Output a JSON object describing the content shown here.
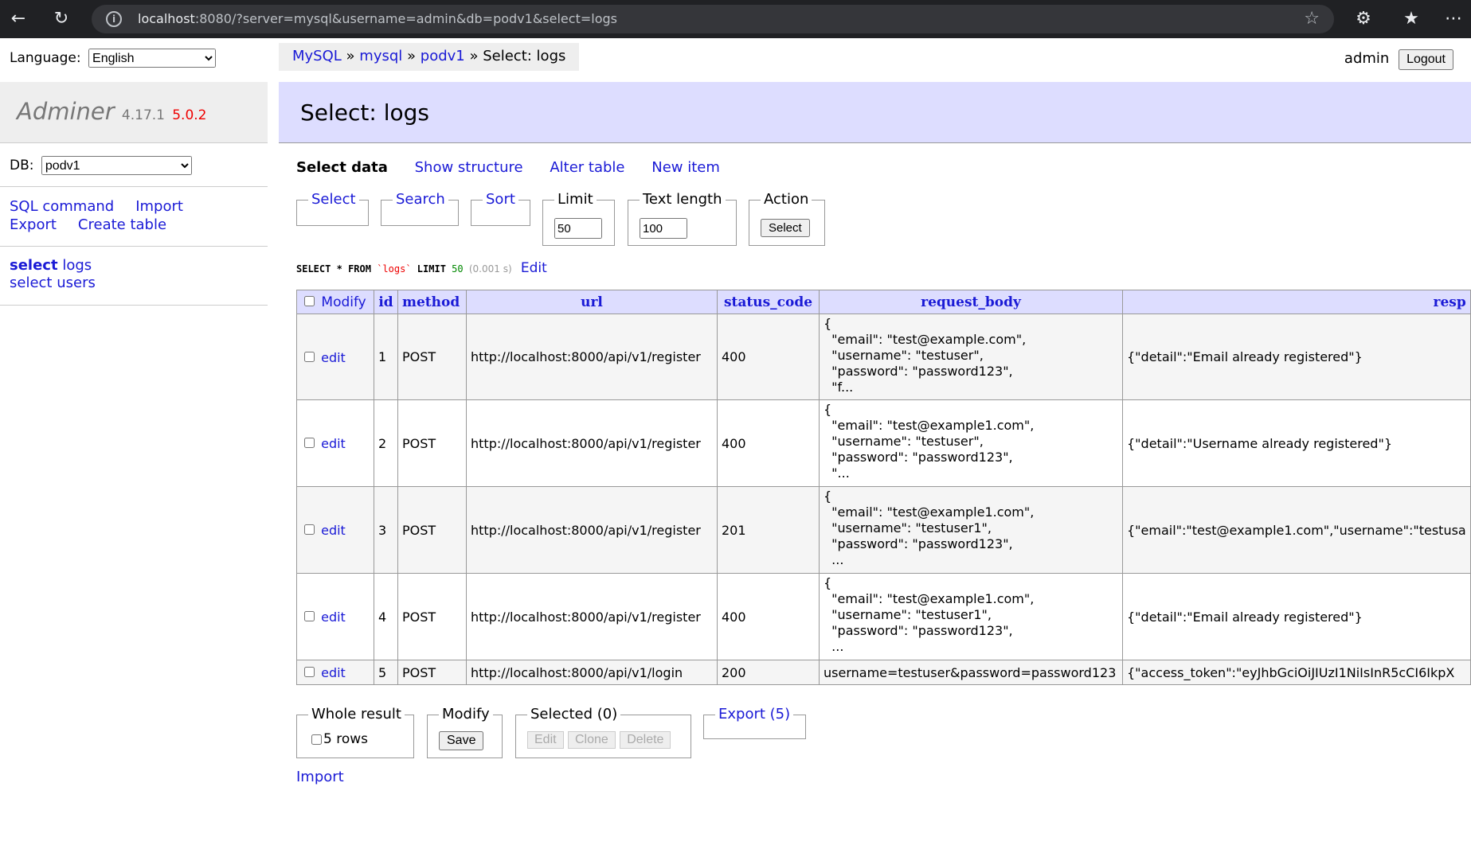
{
  "browser": {
    "url_host": "localhost",
    "url_rest": ":8080/?server=mysql&username=admin&db=podv1&select=logs"
  },
  "sidebar": {
    "language_label": "Language:",
    "language_value": "English",
    "app_name": "Adminer",
    "version": "4.17.1",
    "new_version": "5.0.2",
    "db_label": "DB:",
    "db_value": "podv1",
    "links": [
      "SQL command",
      "Import",
      "Export",
      "Create table"
    ],
    "tables": [
      {
        "action": "select",
        "name": "logs"
      },
      {
        "action": "select",
        "name": "users"
      }
    ]
  },
  "breadcrumb": {
    "items": [
      "MySQL",
      "mysql",
      "podv1"
    ],
    "current": "Select: logs",
    "separator": "»"
  },
  "header": {
    "user": "admin",
    "logout_label": "Logout",
    "title": "Select: logs"
  },
  "menu": {
    "items": [
      "Select data",
      "Show structure",
      "Alter table",
      "New item"
    ]
  },
  "filters": {
    "select_label": "Select",
    "search_label": "Search",
    "sort_label": "Sort",
    "limit_label": "Limit",
    "limit_value": "50",
    "text_length_label": "Text length",
    "text_length_value": "100",
    "action_label": "Action",
    "action_button": "Select"
  },
  "query": {
    "kw1": "SELECT",
    "star": "*",
    "kw2": "FROM",
    "table": "`logs`",
    "kw3": "LIMIT",
    "limit": "50",
    "time": "(0.001 s)",
    "edit_label": "Edit"
  },
  "table": {
    "headers": [
      "Modify",
      "id",
      "method",
      "url",
      "status_code",
      "request_body",
      "resp"
    ],
    "edit_label": "edit",
    "rows": [
      {
        "id": "1",
        "method": "POST",
        "url": "http://localhost:8000/api/v1/register",
        "status": "400",
        "body": [
          "{",
          "  \"email\": \"test@example.com\",",
          "  \"username\": \"testuser\",",
          "  \"password\": \"password123\",",
          "  \"f..."
        ],
        "resp": "{\"detail\":\"Email already registered\"}"
      },
      {
        "id": "2",
        "method": "POST",
        "url": "http://localhost:8000/api/v1/register",
        "status": "400",
        "body": [
          "{",
          "  \"email\": \"test@example1.com\",",
          "  \"username\": \"testuser\",",
          "  \"password\": \"password123\",",
          "  \"..."
        ],
        "resp": "{\"detail\":\"Username already registered\"}"
      },
      {
        "id": "3",
        "method": "POST",
        "url": "http://localhost:8000/api/v1/register",
        "status": "201",
        "body": [
          "{",
          "  \"email\": \"test@example1.com\",",
          "  \"username\": \"testuser1\",",
          "  \"password\": \"password123\",",
          "  ..."
        ],
        "resp": "{\"email\":\"test@example1.com\",\"username\":\"testusa"
      },
      {
        "id": "4",
        "method": "POST",
        "url": "http://localhost:8000/api/v1/register",
        "status": "400",
        "body": [
          "{",
          "  \"email\": \"test@example1.com\",",
          "  \"username\": \"testuser1\",",
          "  \"password\": \"password123\",",
          "  ..."
        ],
        "resp": "{\"detail\":\"Email already registered\"}"
      },
      {
        "id": "5",
        "method": "POST",
        "url": "http://localhost:8000/api/v1/login",
        "status": "200",
        "body": [
          "username=testuser&password=password123"
        ],
        "resp": "{\"access_token\":\"eyJhbGciOiJIUzI1NiIsInR5cCI6IkpX"
      }
    ]
  },
  "bottom": {
    "whole_result_label": "Whole result",
    "rows_label": "5 rows",
    "modify_label": "Modify",
    "save_label": "Save",
    "selected_label": "Selected (0)",
    "edit_btn": "Edit",
    "clone_btn": "Clone",
    "delete_btn": "Delete",
    "export_label": "Export (5)",
    "import_label": "Import"
  }
}
